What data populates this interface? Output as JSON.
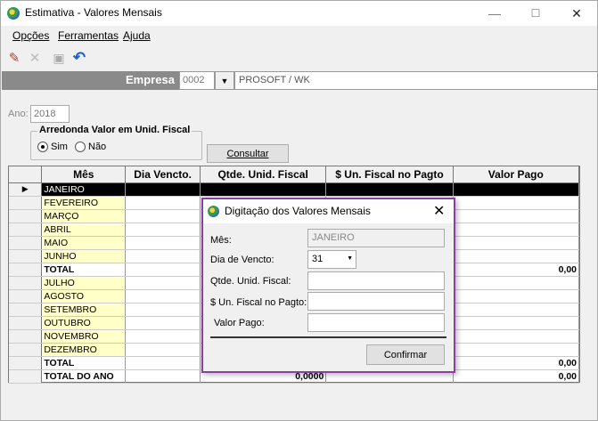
{
  "window": {
    "title": "Estimativa - Valores Mensais",
    "min_glyph": "—",
    "max_glyph": "☐",
    "close_glyph": "✕"
  },
  "menu": [
    "Opções",
    "Ferramentas",
    "Ajuda"
  ],
  "toolbar": {
    "icons": [
      "pencil-icon",
      "cancel-icon",
      "save-icon",
      "undo-icon"
    ],
    "pencil_glyph": "✎",
    "cancel_glyph": "✕",
    "save_glyph": "▣",
    "undo_glyph": "↶"
  },
  "empresa": {
    "label": "Empresa",
    "code": "0002",
    "dropdown_glyph": "▼",
    "name": "PROSOFT / WK"
  },
  "ano": {
    "label": "Ano:",
    "value": "2018"
  },
  "arredonda": {
    "title": "Arredonda Valor em Unid. Fiscal",
    "options": [
      "Sim",
      "Não"
    ],
    "selected": "Sim"
  },
  "consultar_label": "Consultar",
  "grid": {
    "row_indicator": "▶",
    "columns": [
      "Mês",
      "Dia Vencto.",
      "Qtde. Unid. Fiscal",
      "$ Un. Fiscal no Pagto",
      "Valor Pago"
    ],
    "rows": [
      {
        "mes": "JANEIRO",
        "valor": ""
      },
      {
        "mes": "FEVEREIRO",
        "valor": ""
      },
      {
        "mes": "MARÇO",
        "valor": ""
      },
      {
        "mes": "ABRIL",
        "valor": ""
      },
      {
        "mes": "MAIO",
        "valor": ""
      },
      {
        "mes": "JUNHO",
        "valor": ""
      },
      {
        "mes": "TOTAL",
        "valor": "0,00"
      },
      {
        "mes": "JULHO",
        "valor": ""
      },
      {
        "mes": "AGOSTO",
        "valor": ""
      },
      {
        "mes": "SETEMBRO",
        "valor": ""
      },
      {
        "mes": "OUTUBRO",
        "valor": ""
      },
      {
        "mes": "NOVEMBRO",
        "valor": ""
      },
      {
        "mes": "DEZEMBRO",
        "valor": ""
      },
      {
        "mes": "TOTAL",
        "valor": "0,00"
      },
      {
        "mes": "TOTAL DO ANO",
        "qtde": "0,0000",
        "valor": "0,00"
      }
    ]
  },
  "dialog": {
    "title": "Digitação dos Valores Mensais",
    "close_glyph": "✕",
    "mes_label": "Mês:",
    "mes_value": "JANEIRO",
    "dia_label": "Dia de Vencto:",
    "dia_value": "31",
    "dia_dropdown_glyph": "▼",
    "qtde_label": "Qtde. Unid. Fiscal:",
    "qtde_value": "",
    "unfiscal_label": "$ Un. Fiscal no Pagto:",
    "unfiscal_value": "",
    "valor_label": "Valor Pago:",
    "valor_value": "",
    "confirmar_label": "Confirmar"
  }
}
